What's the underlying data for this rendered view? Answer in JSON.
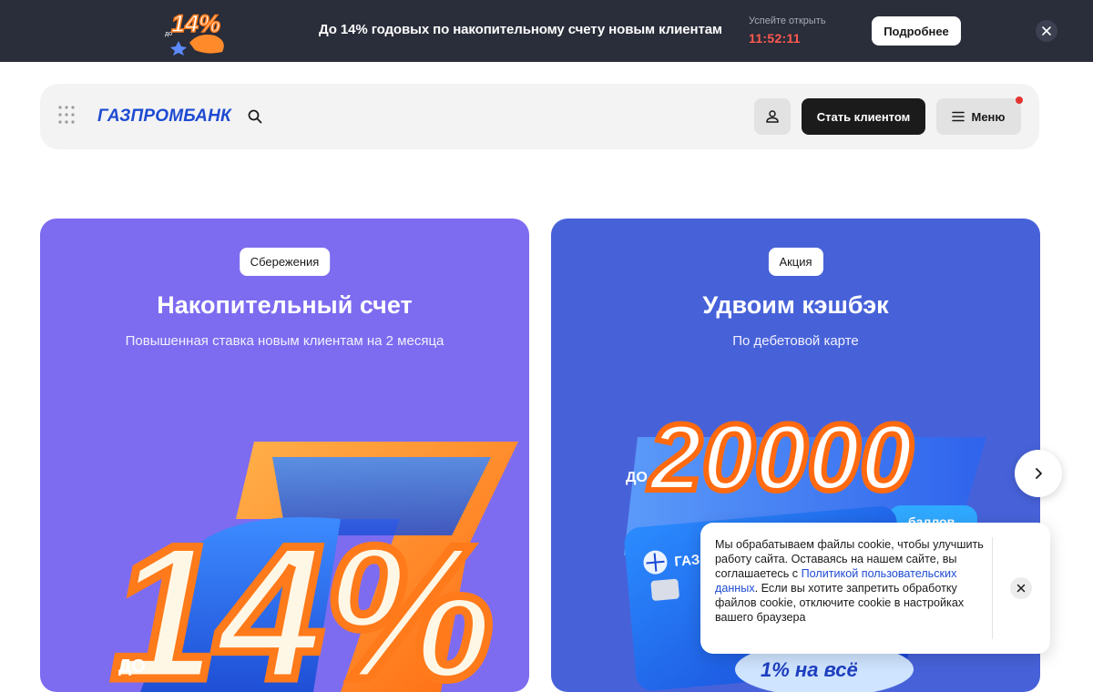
{
  "promo": {
    "badge_prefix": "до",
    "badge_value": "14%",
    "text": "До 14% годовых по накопительному счету новым клиентам",
    "hurry_label": "Успейте открыть",
    "timer": "11:52:11",
    "button_label": "Подробнее",
    "close_icon": "close-icon"
  },
  "header": {
    "logo_text": "ГАЗПРОМБАНК",
    "apps_icon": "grid-dots-icon",
    "search_icon": "search-icon",
    "profile_icon": "user-icon",
    "cta_label": "Стать клиентом",
    "menu_label": "Меню",
    "menu_icon": "hamburger-icon"
  },
  "cards": [
    {
      "tag": "Сбережения",
      "title": "Накопительный счет",
      "subtitle": "Повышенная ставка новым клиентам на 2 месяца",
      "art_prefix": "ДО",
      "art_value": "14%"
    },
    {
      "tag": "Акция",
      "title": "Удвоим кэшбэк",
      "subtitle": "По дебетовой карте",
      "art_prefix": "ДО",
      "art_value": "20000",
      "art_points": "баллов",
      "art_card_brand": "ГАЗ",
      "art_bubble": "1% на всё"
    }
  ],
  "carousel": {
    "next_icon": "chevron-right-icon"
  },
  "cookie": {
    "text_before": "Мы обрабатываем файлы cookie, чтобы улучшить работу сайта. Оставаясь на нашем сайте, вы соглашаетесь с ",
    "link_text": "Политикой пользовательских данных",
    "text_after": ". Если вы хотите запретить обработку файлов cookie, отключите cookie в настройках вашего браузера",
    "close_icon": "close-icon"
  },
  "colors": {
    "promo_bg": "#2a2d3a",
    "timer": "#ff5a4e",
    "brand_blue": "#1e4bd2",
    "card1_bg": "#7d6cf0",
    "card2_bg": "#4762d9",
    "accent_orange": "#ff7a1a",
    "notification_dot": "#e3342f"
  }
}
